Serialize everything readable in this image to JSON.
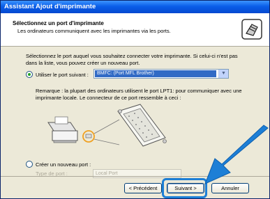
{
  "window": {
    "title": "Assistant Ajout d'imprimante"
  },
  "header": {
    "title": "Sélectionnez un port d'imprimante",
    "subtitle": "Les ordinateurs communiquent avec les imprimantes via les ports."
  },
  "content": {
    "intro": "Sélectionnez le port auquel vous souhaitez connecter votre imprimante. Si celui-ci n'est pas dans la liste, vous pouvez créer un nouveau port.",
    "use_port": {
      "label": "Utiliser le port suivant :",
      "selected": true,
      "value": "BMFC: (Port MFL Brother)"
    },
    "note": "Remarque : la plupart des ordinateurs utilisent le port LPT1: pour communiquer avec une imprimante locale. Le connecteur de ce port ressemble à ceci :",
    "create_port": {
      "label": "Créer un nouveau port :",
      "selected": false,
      "type_label": "Type de port :",
      "type_value": "Local Port"
    }
  },
  "buttons": {
    "prev": "< Précédent",
    "next": "Suivant >",
    "cancel": "Annuler"
  },
  "colors": {
    "title_bar": "#0a5ee8",
    "selection": "#316ac5",
    "highlight": "#1d7fd6",
    "radio_dot": "#21a121"
  }
}
